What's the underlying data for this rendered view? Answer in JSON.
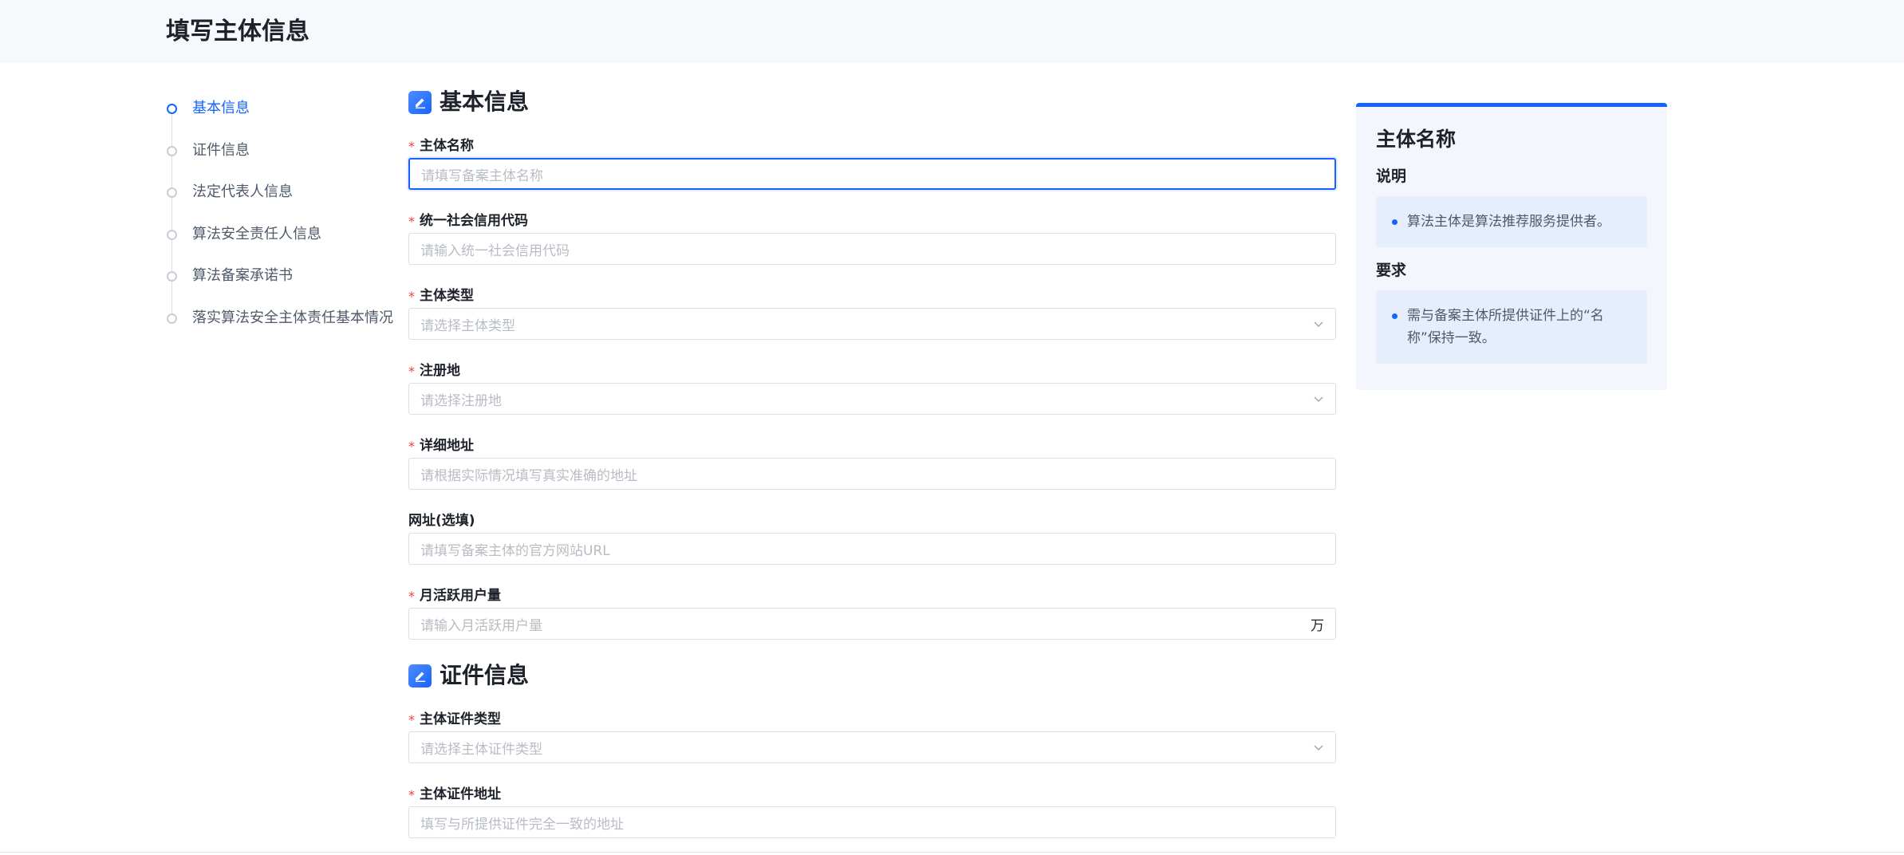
{
  "header": {
    "title": "填写主体信息"
  },
  "steps": [
    {
      "label": "基本信息",
      "active": true
    },
    {
      "label": "证件信息",
      "active": false
    },
    {
      "label": "法定代表人信息",
      "active": false
    },
    {
      "label": "算法安全责任人信息",
      "active": false
    },
    {
      "label": "算法备案承诺书",
      "active": false
    },
    {
      "label": "落实算法安全主体责任基本情况",
      "active": false
    }
  ],
  "sections": {
    "basic": {
      "title": "基本信息",
      "icon": "edit-icon",
      "fields": [
        {
          "label": "主体名称",
          "required": true,
          "placeholder": "请填写备案主体名称",
          "type": "text",
          "focused": true
        },
        {
          "label": "统一社会信用代码",
          "required": true,
          "placeholder": "请输入统一社会信用代码",
          "type": "text"
        },
        {
          "label": "主体类型",
          "required": true,
          "placeholder": "请选择主体类型",
          "type": "select"
        },
        {
          "label": "注册地",
          "required": true,
          "placeholder": "请选择注册地",
          "type": "select"
        },
        {
          "label": "详细地址",
          "required": true,
          "placeholder": "请根据实际情况填写真实准确的地址",
          "type": "text"
        },
        {
          "label": "网址(选填)",
          "required": false,
          "placeholder": "请填写备案主体的官方网站URL",
          "type": "text"
        },
        {
          "label": "月活跃用户量",
          "required": true,
          "placeholder": "请输入月活跃用户量",
          "type": "text",
          "suffix": "万"
        }
      ]
    },
    "cert": {
      "title": "证件信息",
      "icon": "edit-icon",
      "fields": [
        {
          "label": "主体证件类型",
          "required": true,
          "placeholder": "请选择主体证件类型",
          "type": "select"
        },
        {
          "label": "主体证件地址",
          "required": true,
          "placeholder": "填写与所提供证件完全一致的地址",
          "type": "text"
        }
      ]
    }
  },
  "info_panel": {
    "title": "主体名称",
    "desc_title": "说明",
    "desc_text": "算法主体是算法推荐服务提供者。",
    "req_title": "要求",
    "req_text": "需与备案主体所提供证件上的“名称”保持一致。"
  },
  "required_mark": "*",
  "colors": {
    "accent": "#1664ff",
    "required": "#f53f3f"
  }
}
